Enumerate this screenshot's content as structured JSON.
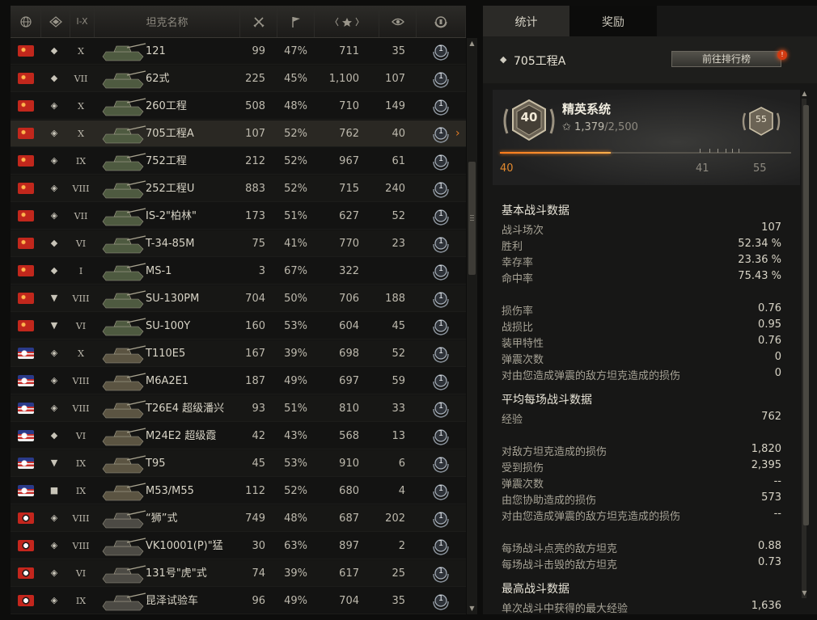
{
  "header": {
    "tier_range": "I-X",
    "name_col": "坦克名称"
  },
  "rows": [
    {
      "nation": "ussr",
      "cls": "lt",
      "tier": "X",
      "name": "121",
      "battles": "99",
      "win": "47%",
      "xp": "711",
      "kills": "35"
    },
    {
      "nation": "ussr",
      "cls": "mt",
      "tier": "VII",
      "name": "62式",
      "battles": "225",
      "win": "45%",
      "xp": "1,100",
      "kills": "107"
    },
    {
      "nation": "ussr",
      "cls": "ht",
      "tier": "X",
      "name": "260工程",
      "battles": "508",
      "win": "48%",
      "xp": "710",
      "kills": "149"
    },
    {
      "nation": "ussr",
      "cls": "ht",
      "tier": "X",
      "name": "705工程A",
      "battles": "107",
      "win": "52%",
      "xp": "762",
      "kills": "40",
      "selected": true
    },
    {
      "nation": "ussr",
      "cls": "ht",
      "tier": "IX",
      "name": "752工程",
      "battles": "212",
      "win": "52%",
      "xp": "967",
      "kills": "61"
    },
    {
      "nation": "ussr",
      "cls": "ht",
      "tier": "VIII",
      "name": "252工程U",
      "battles": "883",
      "win": "52%",
      "xp": "715",
      "kills": "240"
    },
    {
      "nation": "ussr",
      "cls": "ht",
      "tier": "VII",
      "name": "IS-2\"柏林\"",
      "battles": "173",
      "win": "51%",
      "xp": "627",
      "kills": "52"
    },
    {
      "nation": "ussr",
      "cls": "mt",
      "tier": "VI",
      "name": "T-34-85M",
      "battles": "75",
      "win": "41%",
      "xp": "770",
      "kills": "23"
    },
    {
      "nation": "ussr",
      "cls": "mt",
      "tier": "I",
      "name": "MS-1",
      "battles": "3",
      "win": "67%",
      "xp": "322",
      "kills": ""
    },
    {
      "nation": "ussr",
      "cls": "td",
      "tier": "VIII",
      "name": "SU-130PM",
      "battles": "704",
      "win": "50%",
      "xp": "706",
      "kills": "188"
    },
    {
      "nation": "ussr",
      "cls": "td",
      "tier": "VI",
      "name": "SU-100Y",
      "battles": "160",
      "win": "53%",
      "xp": "604",
      "kills": "45"
    },
    {
      "nation": "usa",
      "cls": "ht",
      "tier": "X",
      "name": "T110E5",
      "battles": "167",
      "win": "39%",
      "xp": "698",
      "kills": "52"
    },
    {
      "nation": "usa",
      "cls": "ht",
      "tier": "VIII",
      "name": "M6A2E1",
      "battles": "187",
      "win": "49%",
      "xp": "697",
      "kills": "59"
    },
    {
      "nation": "usa",
      "cls": "ht",
      "tier": "VIII",
      "name": "T26E4 超级潘兴",
      "battles": "93",
      "win": "51%",
      "xp": "810",
      "kills": "33"
    },
    {
      "nation": "usa",
      "cls": "mt",
      "tier": "VI",
      "name": "M24E2 超级霞",
      "battles": "42",
      "win": "43%",
      "xp": "568",
      "kills": "13"
    },
    {
      "nation": "usa",
      "cls": "td",
      "tier": "IX",
      "name": "T95",
      "battles": "45",
      "win": "53%",
      "xp": "910",
      "kills": "6"
    },
    {
      "nation": "usa",
      "cls": "spg",
      "tier": "IX",
      "name": "M53/M55",
      "battles": "112",
      "win": "52%",
      "xp": "680",
      "kills": "4"
    },
    {
      "nation": "ger",
      "cls": "ht",
      "tier": "VIII",
      "name": "“狮”式",
      "battles": "749",
      "win": "48%",
      "xp": "687",
      "kills": "202"
    },
    {
      "nation": "ger",
      "cls": "ht",
      "tier": "VIII",
      "name": "VK10001(P)\"猛",
      "battles": "30",
      "win": "63%",
      "xp": "897",
      "kills": "2"
    },
    {
      "nation": "ger",
      "cls": "ht",
      "tier": "VI",
      "name": "131号\"虎\"式",
      "battles": "74",
      "win": "39%",
      "xp": "617",
      "kills": "25"
    },
    {
      "nation": "ger",
      "cls": "ht",
      "tier": "IX",
      "name": "昆泽试验车",
      "battles": "96",
      "win": "49%",
      "xp": "704",
      "kills": "35"
    }
  ],
  "mastery_badge": "1",
  "tabs": {
    "stats": "统计",
    "awards": "奖励"
  },
  "selected_tank": {
    "name": "705工程A",
    "rank_button": "前往排行榜",
    "notification": "!"
  },
  "elite": {
    "title": "精英系统",
    "level_badge": "40",
    "next_badge": "55",
    "xp_current": "1,379",
    "xp_total": "/2,500",
    "progress": 0.38,
    "levels": {
      "current": "40",
      "next": "41",
      "max": "55"
    }
  },
  "basic": {
    "title": "基本战斗数据",
    "rows": [
      {
        "k": "战斗场次",
        "v": "107"
      },
      {
        "k": "胜利",
        "v": "52.34 %"
      },
      {
        "k": "幸存率",
        "v": "23.36 %"
      },
      {
        "k": "命中率",
        "v": "75.43 %"
      },
      {
        "k": "损伤率",
        "v": "0.76"
      },
      {
        "k": "战损比",
        "v": "0.95"
      },
      {
        "k": "装甲特性",
        "v": "0.76"
      },
      {
        "k": "弹震次数",
        "v": "0"
      },
      {
        "k": "对由您造成弹震的敌方坦克造成的损伤",
        "v": "0"
      }
    ]
  },
  "average": {
    "title": "平均每场战斗数据",
    "rows": [
      {
        "k": "经验",
        "v": "762"
      },
      {
        "k": "对敌方坦克造成的损伤",
        "v": "1,820"
      },
      {
        "k": "受到损伤",
        "v": "2,395"
      },
      {
        "k": "弹震次数",
        "v": "--"
      },
      {
        "k": "由您协助造成的损伤",
        "v": "573"
      },
      {
        "k": "对由您造成弹震的敌方坦克造成的损伤",
        "v": "--"
      },
      {
        "k": "每场战斗点亮的敌方坦克",
        "v": "0.88"
      },
      {
        "k": "每场战斗击毁的敌方坦克",
        "v": "0.73"
      }
    ]
  },
  "best": {
    "title": "最高战斗数据",
    "rows": [
      {
        "k": "单次战斗中获得的最大经验",
        "v": "1,636"
      }
    ]
  }
}
